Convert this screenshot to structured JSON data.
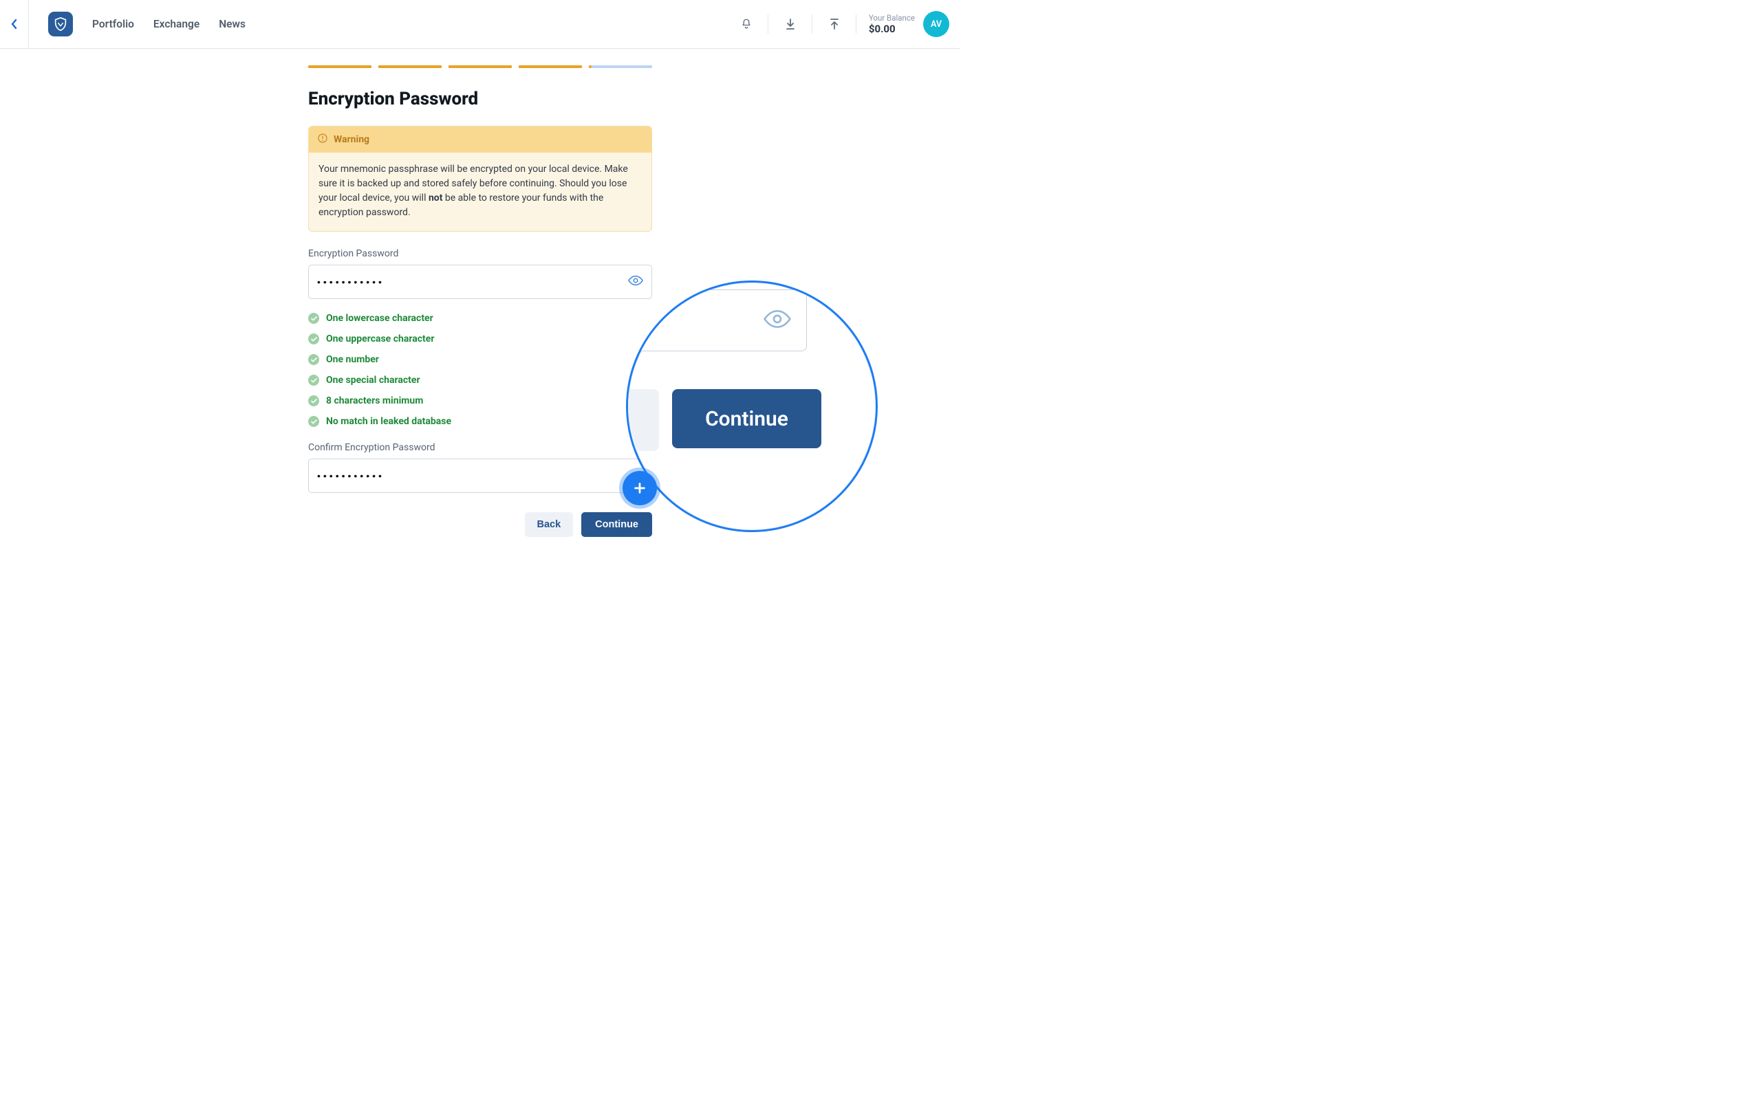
{
  "nav": {
    "portfolio": "Portfolio",
    "exchange": "Exchange",
    "news": "News"
  },
  "balance": {
    "label": "Your Balance",
    "value": "$0.00"
  },
  "avatar": "AV",
  "title": "Encryption Password",
  "warning": {
    "label": "Warning",
    "body_pre": "Your mnemonic passphrase will be encrypted on your local device. Make sure it is backed up and stored safely before continuing. Should you lose your local device, you will ",
    "body_bold": "not",
    "body_post": " be able to restore your funds with the encryption password."
  },
  "fields": {
    "password_label": "Encryption Password",
    "password_value": "•••••••••••",
    "confirm_label": "Confirm Encryption Password",
    "confirm_value": "•••••••••••"
  },
  "rules": {
    "r0": "One lowercase character",
    "r1": "One uppercase character",
    "r2": "One number",
    "r3": "One special character",
    "r4": "8 characters minimum",
    "r5": "No match in leaked database"
  },
  "actions": {
    "back": "Back",
    "continue": "Continue"
  },
  "magnifier": {
    "continue": "Continue"
  }
}
